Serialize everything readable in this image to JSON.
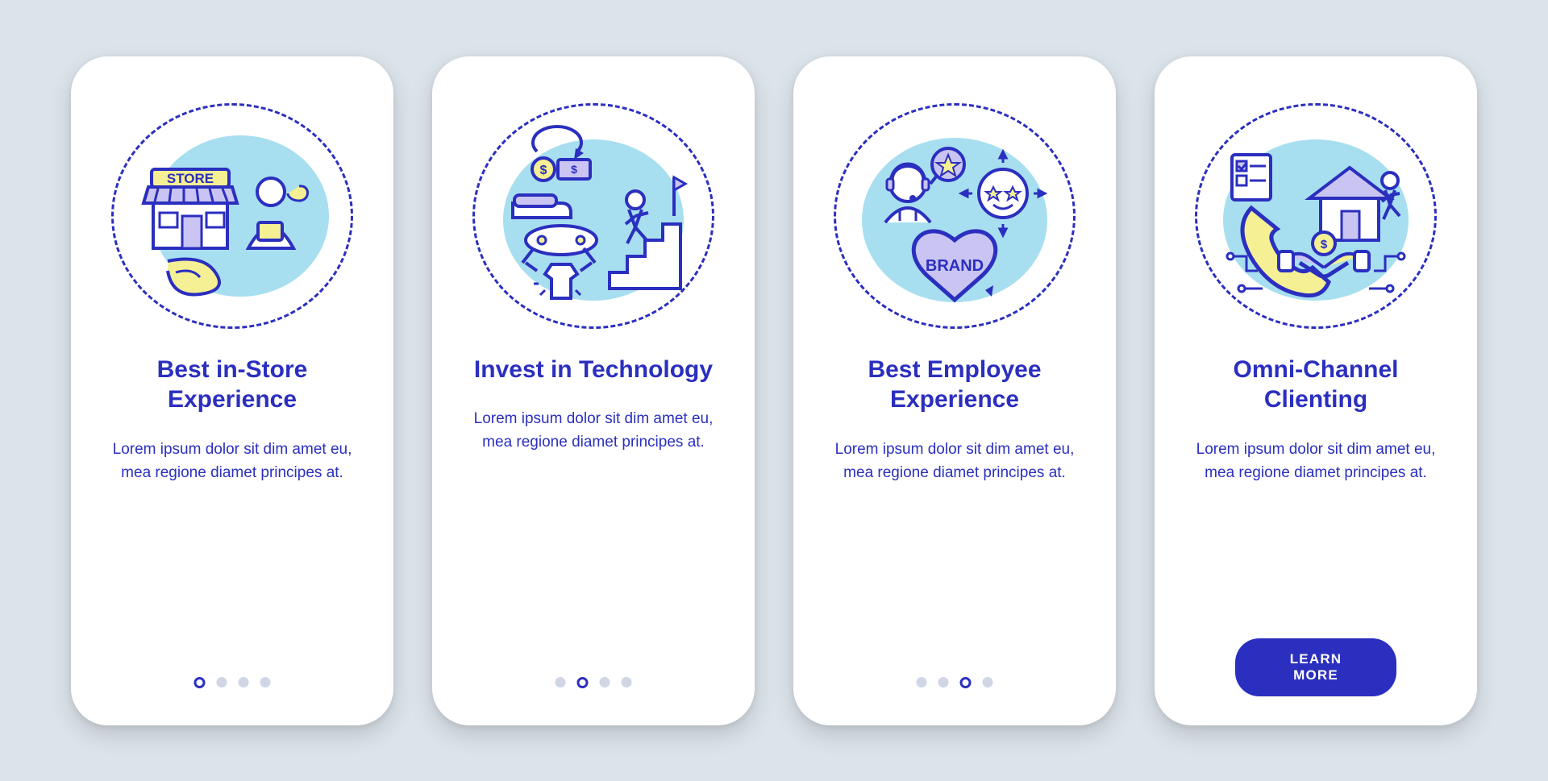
{
  "colors": {
    "accent": "#2b2fbf",
    "blob": "#a8dff0",
    "yellow": "#f5f093",
    "purple": "#c9c4f2",
    "stroke": "#2b2fbf",
    "page_bg": "#dce4eb"
  },
  "screens": [
    {
      "title": "Best in-Store Experience",
      "desc": "Lorem ipsum dolor sit dim amet eu, mea regione diamet principes at.",
      "active_dot": 0,
      "has_dots": true,
      "icon": "store-experience-icon",
      "store_label": "STORE"
    },
    {
      "title": "Invest in Technology",
      "desc": "Lorem ipsum dolor sit dim amet eu, mea regione diamet principes at.",
      "active_dot": 1,
      "has_dots": true,
      "icon": "invest-technology-icon"
    },
    {
      "title": "Best Employee Experience",
      "desc": "Lorem ipsum dolor sit dim amet eu, mea regione diamet principes at.",
      "active_dot": 2,
      "has_dots": true,
      "icon": "employee-experience-icon",
      "brand_label": "BRAND"
    },
    {
      "title": "Omni-Channel Clienting",
      "desc": "Lorem ipsum dolor sit dim amet eu, mea regione diamet principes at.",
      "has_dots": false,
      "icon": "omni-channel-icon",
      "cta": "LEARN MORE"
    }
  ],
  "total_dots": 4
}
